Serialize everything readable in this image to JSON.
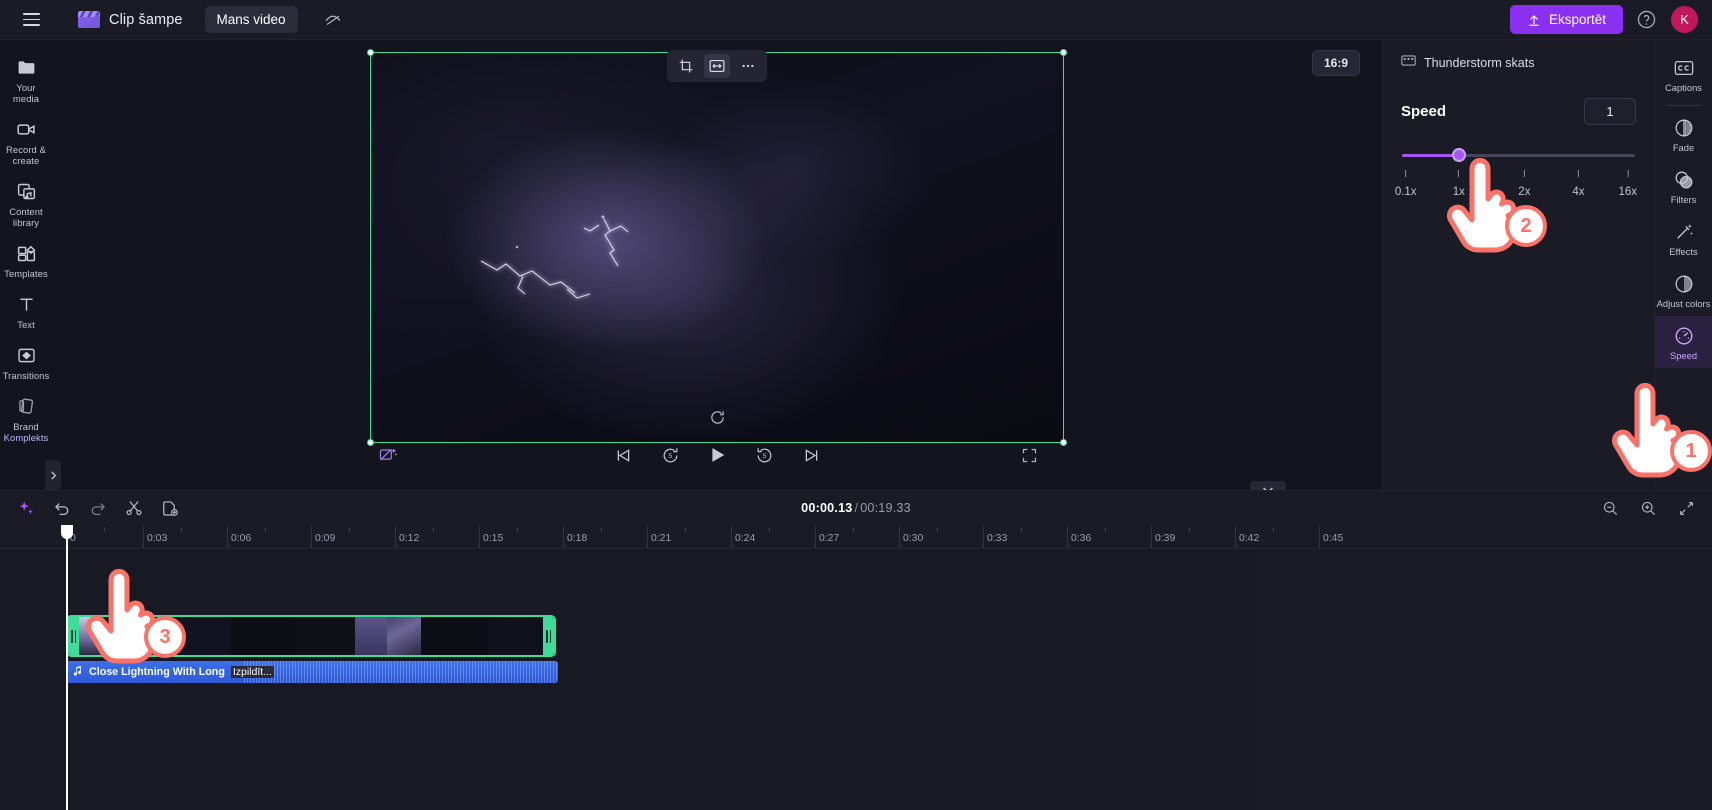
{
  "topbar": {
    "menu_icon": "hamburger-icon",
    "brand_name": "Clip šampe",
    "project_tab": "Mans video",
    "eye_off_icon": "eye-off-icon",
    "export_label": "Eksportēt",
    "export_icon": "upload-icon",
    "help_icon": "help-circle-icon",
    "avatar_initial": "K",
    "export_color": "#8b2ff0",
    "avatar_color": "#c2185b"
  },
  "left_rail": {
    "items": [
      {
        "label": "Your media",
        "icon": "folder-icon"
      },
      {
        "label": "Record & create",
        "icon": "camera-record-icon"
      },
      {
        "label": "Content library",
        "icon": "content-library-icon"
      },
      {
        "label": "Templates",
        "icon": "templates-grid-icon"
      },
      {
        "label": "Text",
        "icon": "text-t-icon"
      },
      {
        "label": "Transitions",
        "icon": "transitions-icon"
      },
      {
        "label": "Brand ",
        "label_hl": "Komplekts",
        "icon": "brand-kit-icon"
      }
    ],
    "expander_icon": "chevron-right-icon"
  },
  "preview": {
    "tools": [
      {
        "name": "crop-button",
        "icon": "crop-icon"
      },
      {
        "name": "fit-button",
        "icon": "fit-resize-icon"
      },
      {
        "name": "more-button",
        "icon": "ellipsis-icon"
      }
    ],
    "aspect_ratio": "16:9",
    "watermark_icon": "watermark-remove-icon",
    "loop_icon": "loop-icon",
    "transport": [
      {
        "name": "skip-start-button",
        "icon": "skip-to-start-icon"
      },
      {
        "name": "rewind-5-button",
        "icon": "rewind-5s-icon"
      },
      {
        "name": "play-button",
        "icon": "play-icon"
      },
      {
        "name": "forward-5-button",
        "icon": "forward-5s-icon"
      },
      {
        "name": "skip-end-button",
        "icon": "skip-to-end-icon"
      }
    ],
    "fullscreen_icon": "fullscreen-icon",
    "collapse_icon": "chevron-down-icon",
    "selection_color": "#3ddc97"
  },
  "right_panel": {
    "clip_name": "Thunderstorm skats",
    "clip_icon": "film-strip-icon",
    "speed_label": "Speed",
    "speed_value": "1",
    "slider": {
      "fill_percent": 24.6,
      "accent": "#a855f7",
      "ticks": [
        {
          "label": "0.1x",
          "pos": 2
        },
        {
          "label": "1x",
          "pos": 24.6
        },
        {
          "label": "2x",
          "pos": 52.5
        },
        {
          "label": "4x",
          "pos": 75.5
        },
        {
          "label": "16x",
          "pos": 96.5
        }
      ]
    }
  },
  "icon_rail": {
    "items": [
      {
        "label": "Captions",
        "icon": "captions-cc-icon",
        "active": false
      },
      {
        "label": "Fade",
        "icon": "fade-icon",
        "active": false
      },
      {
        "label": "Filters",
        "icon": "filters-icon",
        "active": false
      },
      {
        "label": "Effects",
        "icon": "effects-wand-icon",
        "active": false
      },
      {
        "label": "Adjust colors",
        "icon": "adjust-colors-icon",
        "active": false
      },
      {
        "label": "Speed",
        "icon": "speedometer-icon",
        "active": true
      }
    ]
  },
  "timeline": {
    "tools": [
      {
        "name": "ai-magic-button",
        "icon": "sparkle-icon"
      },
      {
        "name": "undo-button",
        "icon": "undo-arrow-icon"
      },
      {
        "name": "redo-button",
        "icon": "redo-arrow-icon"
      },
      {
        "name": "split-button",
        "icon": "scissors-icon"
      },
      {
        "name": "duplicate-button",
        "icon": "duplicate-add-icon"
      }
    ],
    "current_time": "00:00.13",
    "separator": "/",
    "total_time": "00:19.33",
    "right_tools": [
      {
        "name": "zoom-out-button",
        "icon": "zoom-out-icon"
      },
      {
        "name": "zoom-in-button",
        "icon": "zoom-in-icon"
      },
      {
        "name": "fit-timeline-button",
        "icon": "fit-timeline-icon"
      }
    ],
    "ruler_labels": [
      "0",
      "0:03",
      "0:06",
      "0:09",
      "0:12",
      "0:15",
      "0:18",
      "0:21",
      "0:24",
      "0:27",
      "0:30",
      "0:33",
      "0:36",
      "0:39",
      "0:42",
      "0:45"
    ],
    "video_clip": {
      "name": "video-clip",
      "selected": true
    },
    "audio_clip": {
      "icon": "music-note-icon",
      "title": "Close Lightning With Long",
      "suffix": "Izpildīt...",
      "color": "#3b6fe8"
    }
  },
  "annotations": {
    "color": "#fa7268",
    "steps": [
      {
        "number": "1",
        "target": "speed-rail-button"
      },
      {
        "number": "2",
        "target": "speed-slider"
      },
      {
        "number": "3",
        "target": "undo-button"
      }
    ]
  }
}
